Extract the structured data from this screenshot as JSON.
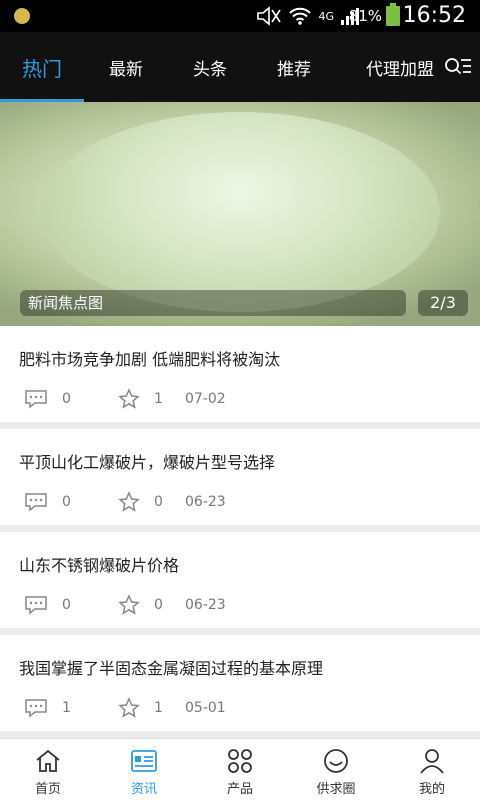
{
  "status_bar": {
    "battery_pct": "81%",
    "network": "4G",
    "time": "16:52"
  },
  "top_nav": {
    "tabs": [
      {
        "label": "热门",
        "active": true
      },
      {
        "label": "最新",
        "active": false
      },
      {
        "label": "头条",
        "active": false
      },
      {
        "label": "推荐",
        "active": false
      },
      {
        "label": "代理加盟",
        "active": false
      }
    ],
    "accent_color": "#2a9de0"
  },
  "banner": {
    "caption": "新闻焦点图",
    "pager": "2/3"
  },
  "news": [
    {
      "title": "肥料市场竞争加剧 低端肥料将被淘汰",
      "comments": "0",
      "favorites": "1",
      "date": "07-02"
    },
    {
      "title": "平顶山化工爆破片，爆破片型号选择",
      "comments": "0",
      "favorites": "0",
      "date": "06-23"
    },
    {
      "title": "山东不锈钢爆破片价格",
      "comments": "0",
      "favorites": "0",
      "date": "06-23"
    },
    {
      "title": "我国掌握了半固态金属凝固过程的基本原理",
      "comments": "1",
      "favorites": "1",
      "date": "05-01"
    }
  ],
  "bottom_nav": {
    "items": [
      {
        "label": "首页",
        "icon": "home-icon"
      },
      {
        "label": "资讯",
        "icon": "news-icon",
        "active": true
      },
      {
        "label": "产品",
        "icon": "grid-icon"
      },
      {
        "label": "供求圈",
        "icon": "smile-icon"
      },
      {
        "label": "我的",
        "icon": "user-icon"
      }
    ]
  }
}
